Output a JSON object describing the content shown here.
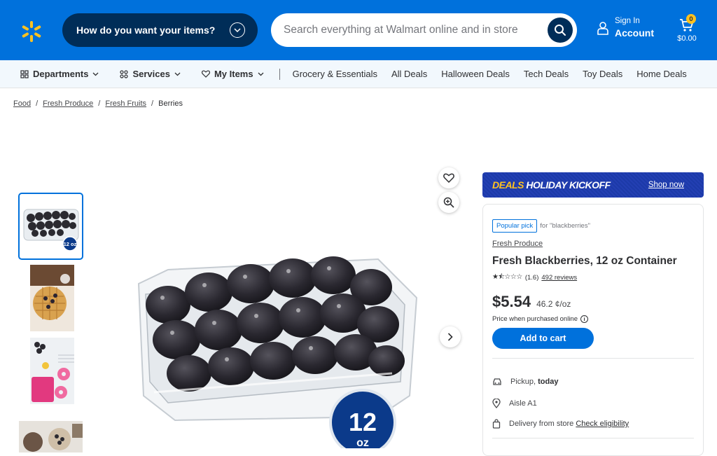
{
  "header": {
    "logo": "walmart-spark-logo",
    "delivery_prompt": "How do you want your items?",
    "search_placeholder": "Search everything at Walmart online and in store",
    "account": {
      "line1": "Sign In",
      "line2": "Account"
    },
    "cart": {
      "count": "0",
      "total": "$0.00"
    },
    "colors": {
      "brand": "#0071dc",
      "dark": "#002d58",
      "spark": "#ffc220"
    }
  },
  "nav": {
    "departments": "Departments",
    "services": "Services",
    "my_items": "My Items",
    "links": [
      "Grocery & Essentials",
      "All Deals",
      "Halloween Deals",
      "Tech Deals",
      "Toy Deals",
      "Home Deals"
    ]
  },
  "breadcrumb": [
    "Food",
    "Fresh Produce",
    "Fresh Fruits",
    "Berries"
  ],
  "gallery": {
    "badge_number": "12",
    "badge_unit": "oz",
    "thumbnail_badge": "12 oz"
  },
  "promo": {
    "deals_word": "DEALS",
    "event": "HOLIDAY KICKOFF",
    "cta": "Shop now"
  },
  "product": {
    "tag": "Popular pick",
    "tag_context": "for \"blackberries\"",
    "category": "Fresh Produce",
    "title": "Fresh Blackberries, 12 oz Container",
    "rating_value": 1.6,
    "rating": "(1.6)",
    "reviews": "492 reviews",
    "price": "$5.54",
    "unit_price": "46.2 ¢/oz",
    "price_note": "Price when purchased online",
    "add_to_cart": "Add to cart"
  },
  "fulfillment": {
    "pickup_label": "Pickup,",
    "pickup_when": "today",
    "aisle": "Aisle A1",
    "delivery_label": "Delivery from store",
    "delivery_link": "Check eligibility"
  }
}
